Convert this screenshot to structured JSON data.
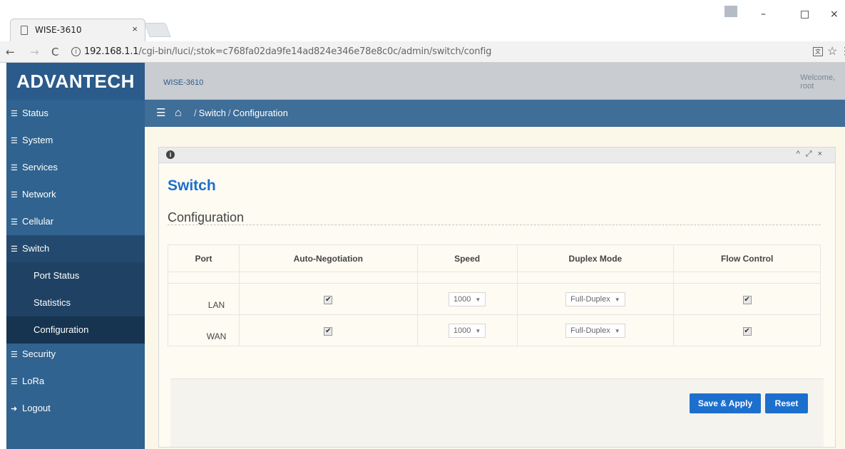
{
  "browser": {
    "tab_title": "WISE-3610",
    "tab_close": "×",
    "url_host": "192.168.1.1",
    "url_path": "/cgi-bin/luci/;stok=c768fa02da9fe14ad824e346e78e8c0c/admin/switch/config",
    "back": "←",
    "forward": "→",
    "reload": "C",
    "minimize": "–",
    "maximize": "□",
    "close": "×"
  },
  "header": {
    "logo": "ADVANTECH",
    "device": "WISE-3610",
    "welcome_line1": "Welcome,",
    "welcome_line2": "root"
  },
  "sidebar": {
    "items": [
      {
        "label": "Status"
      },
      {
        "label": "System"
      },
      {
        "label": "Services"
      },
      {
        "label": "Network"
      },
      {
        "label": "Cellular"
      },
      {
        "label": "Switch"
      },
      {
        "label": "Security"
      },
      {
        "label": "LoRa"
      },
      {
        "label": "Logout"
      }
    ],
    "sub_items": [
      {
        "label": "Port Status"
      },
      {
        "label": "Statistics"
      },
      {
        "label": "Configuration"
      }
    ]
  },
  "breadcrumb": {
    "section": "Switch",
    "separator": "/",
    "page": "Configuration"
  },
  "panel": {
    "title": "Switch",
    "subtitle": "Configuration"
  },
  "table": {
    "headers": [
      "Port",
      "Auto-Negotiation",
      "Speed",
      "Duplex Mode",
      "Flow Control"
    ],
    "rows": [
      {
        "port": "LAN",
        "auto_negotiation": true,
        "speed": "1000",
        "duplex": "Full-Duplex",
        "flow_control": true
      },
      {
        "port": "WAN",
        "auto_negotiation": true,
        "speed": "1000",
        "duplex": "Full-Duplex",
        "flow_control": true
      }
    ]
  },
  "buttons": {
    "save_apply": "Save & Apply",
    "reset": "Reset"
  },
  "colors": {
    "sidebar": "#30638f",
    "accent_blue": "#1d6fce",
    "content_bg": "#fbf8ea"
  }
}
